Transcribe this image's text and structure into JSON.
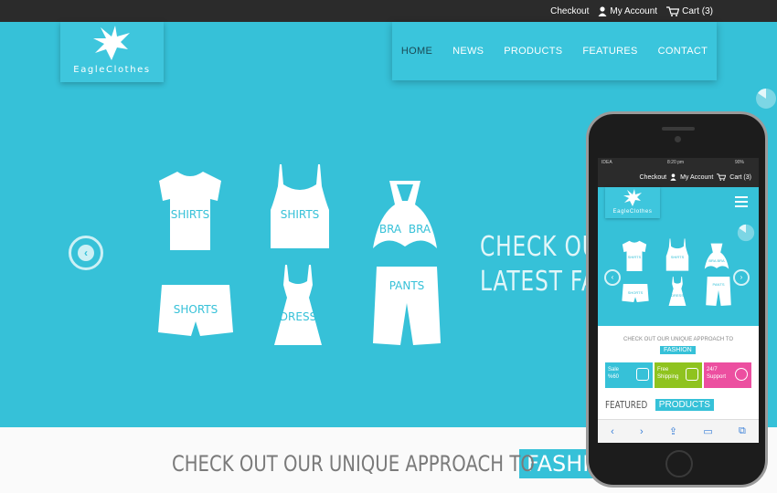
{
  "topbar": {
    "checkout": "Checkout",
    "account": "My Account",
    "cart": "Cart (3)"
  },
  "logo": {
    "name": "EagleClothes"
  },
  "nav": {
    "items": [
      {
        "label": "HOME",
        "active": true
      },
      {
        "label": "NEWS"
      },
      {
        "label": "PRODUCTS"
      },
      {
        "label": "FEATURES"
      },
      {
        "label": "CONTACT"
      }
    ]
  },
  "hero": {
    "garments": [
      {
        "label": "SHIRTS"
      },
      {
        "label": "SHIRTS"
      },
      {
        "label": "BRA",
        "label2": "BRA"
      },
      {
        "label": "SHORTS"
      },
      {
        "label": "DRESS"
      },
      {
        "label": "PANTS"
      }
    ],
    "line1": "CHECK OUR",
    "line2": "LATEST FAS"
  },
  "strip": {
    "text": "CHECK OUT OUR UNIQUE APPROACH TO",
    "highlight": "FASHIO"
  },
  "phone": {
    "status_left": "IDEA",
    "status_time": "8:20 pm",
    "status_right": "90%",
    "checkout": "Checkout",
    "account": "My Account",
    "cart": "Cart (3)",
    "logo_name": "EagleClothes",
    "garments": [
      {
        "label": "SHIRTS"
      },
      {
        "label": "SHIRTS"
      },
      {
        "label": "BRA BRA"
      },
      {
        "label": "SHORTS"
      },
      {
        "label": "DRESS"
      },
      {
        "label": "PANTS"
      }
    ],
    "approach": "CHECK OUT OUR UNIQUE APPROACH TO",
    "fashion": "FASHION",
    "tiles": [
      {
        "line1": "Sale",
        "line2": "%60",
        "color": "#36c1d8"
      },
      {
        "line1": "Free",
        "line2": "Shipping",
        "color": "#8fc31f"
      },
      {
        "line1": "24/7",
        "line2": "Support",
        "color": "#ec4fa0"
      }
    ],
    "featured_a": "FEATURED",
    "featured_b": "PRODUCTS"
  },
  "colors": {
    "accent": "#36c1d8",
    "topbar": "#2b2b2b"
  },
  "icons": [
    "user-icon",
    "cart-icon",
    "eagle-logo-icon",
    "chevron-left-icon",
    "pie-icon",
    "menu-icon"
  ]
}
